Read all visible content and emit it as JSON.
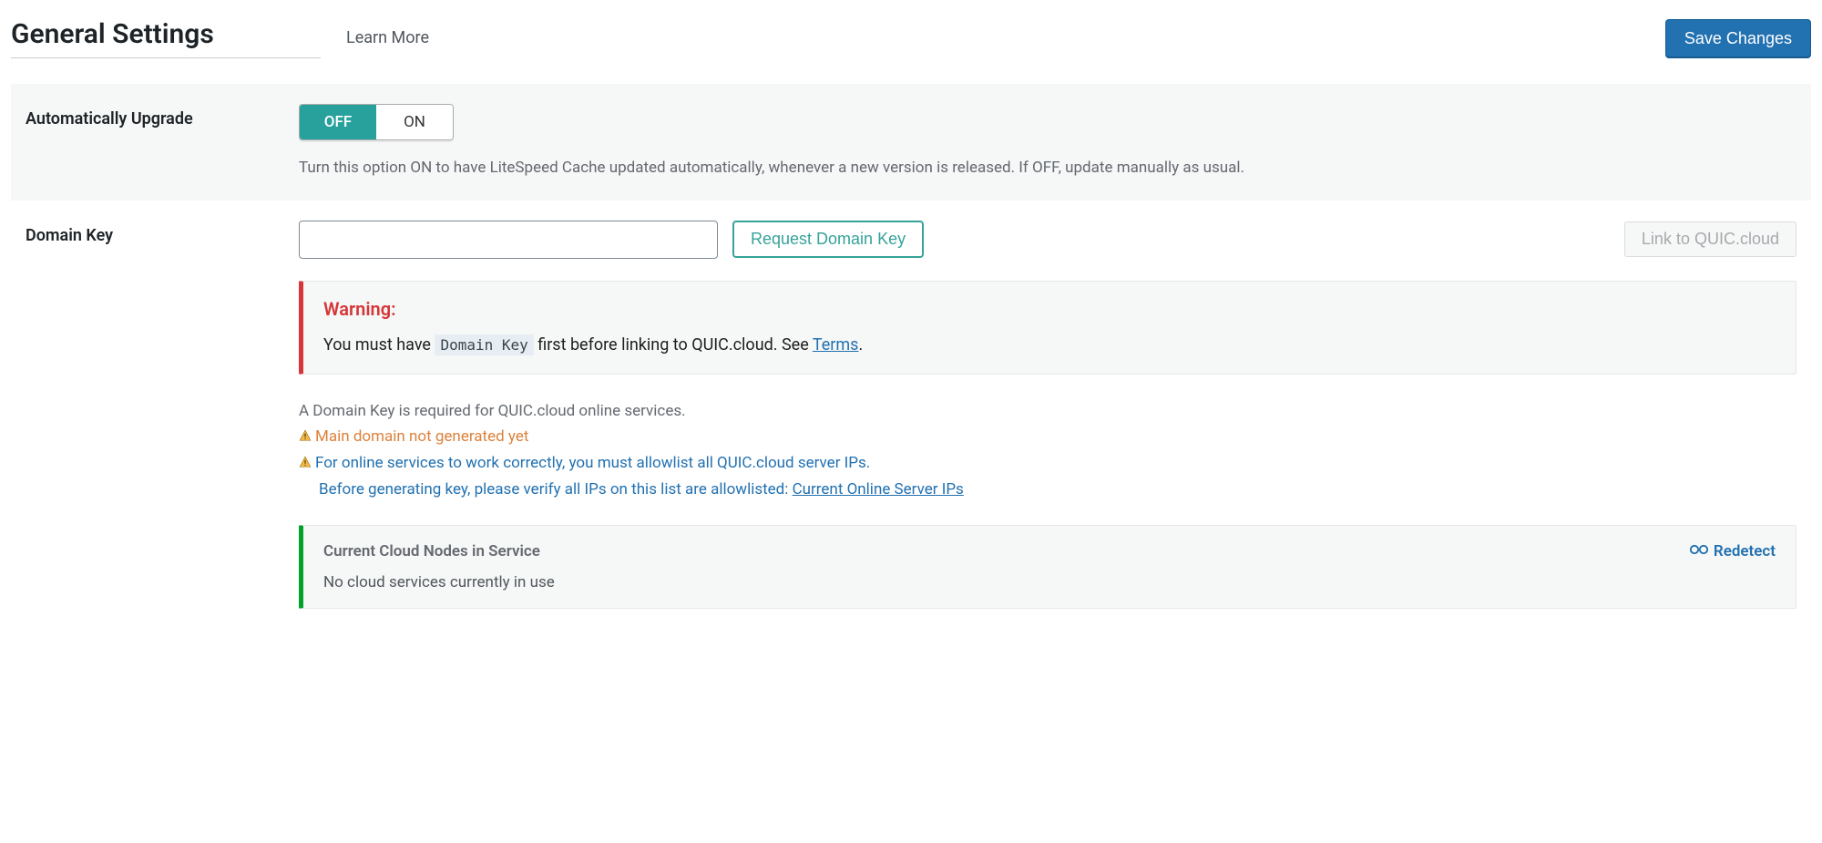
{
  "header": {
    "title": "General Settings",
    "learn_more": "Learn More",
    "save": "Save Changes"
  },
  "auto_upgrade": {
    "label": "Automatically Upgrade",
    "off": "OFF",
    "on": "ON",
    "selected": "OFF",
    "description": "Turn this option ON to have LiteSpeed Cache updated automatically, whenever a new version is released. If OFF, update manually as usual."
  },
  "domain_key": {
    "label": "Domain Key",
    "value": "",
    "request_btn": "Request Domain Key",
    "link_btn": "Link to QUIC.cloud",
    "warning": {
      "title": "Warning:",
      "text_before": "You must have ",
      "code": "Domain Key",
      "text_after": " first before linking to QUIC.cloud. See ",
      "link": "Terms",
      "period": "."
    },
    "info": {
      "line1": "A Domain Key is required for QUIC.cloud online services.",
      "line2": "Main domain not generated yet",
      "line3": "For online services to work correctly, you must allowlist all QUIC.cloud server IPs.",
      "line4_prefix": "Before generating key, please verify all IPs on this list are allowlisted: ",
      "line4_link": "Current Online Server IPs"
    },
    "cloud_nodes": {
      "title": "Current Cloud Nodes in Service",
      "redetect": "Redetect",
      "body": "No cloud services currently in use"
    }
  }
}
